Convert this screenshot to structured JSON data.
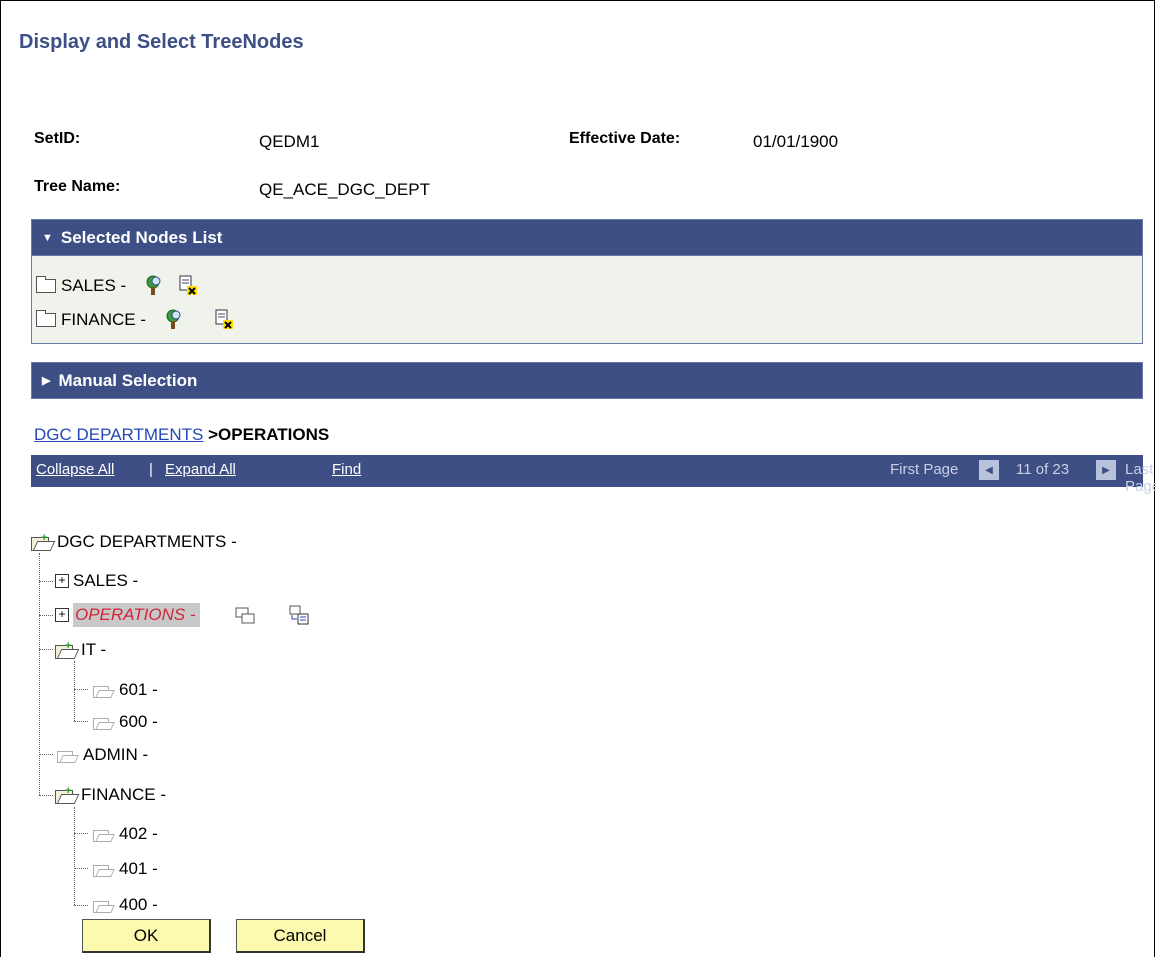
{
  "page": {
    "title": "Display and Select TreeNodes"
  },
  "fields": {
    "setid_label": "SetID:",
    "setid_value": "QEDM1",
    "effdt_label": "Effective Date:",
    "effdt_value": "01/01/1900",
    "tree_label": "Tree Name:",
    "tree_value": "QE_ACE_DGC_DEPT"
  },
  "selected_nodes": {
    "header": "Selected Nodes List",
    "items": [
      {
        "label": "SALES -"
      },
      {
        "label": "FINANCE -"
      }
    ]
  },
  "manual_selection": {
    "header": "Manual Selection"
  },
  "breadcrumb": {
    "root_link": "DGC DEPARTMENTS",
    "current": ">OPERATIONS"
  },
  "navbar": {
    "collapse_all": "Collapse All",
    "separator": "|",
    "expand_all": "Expand All",
    "find": "Find",
    "first_page": "First Page",
    "page_status": "11 of 23",
    "last_page": "Last Page"
  },
  "tree": {
    "root": "DGC DEPARTMENTS -",
    "sales": "SALES -",
    "operations": "OPERATIONS -",
    "it": "IT -",
    "n601": "601 -",
    "n600": "600 -",
    "admin": "ADMIN -",
    "finance": "FINANCE -",
    "n402": "402 -",
    "n401": "401 -",
    "n400": "400 -"
  },
  "buttons": {
    "ok": "OK",
    "cancel": "Cancel"
  },
  "colors": {
    "header_bar": "#3d4f85",
    "panel_bg": "#f0f3ec",
    "button_bg": "#fbfaae",
    "highlight_text": "#d3243a"
  }
}
